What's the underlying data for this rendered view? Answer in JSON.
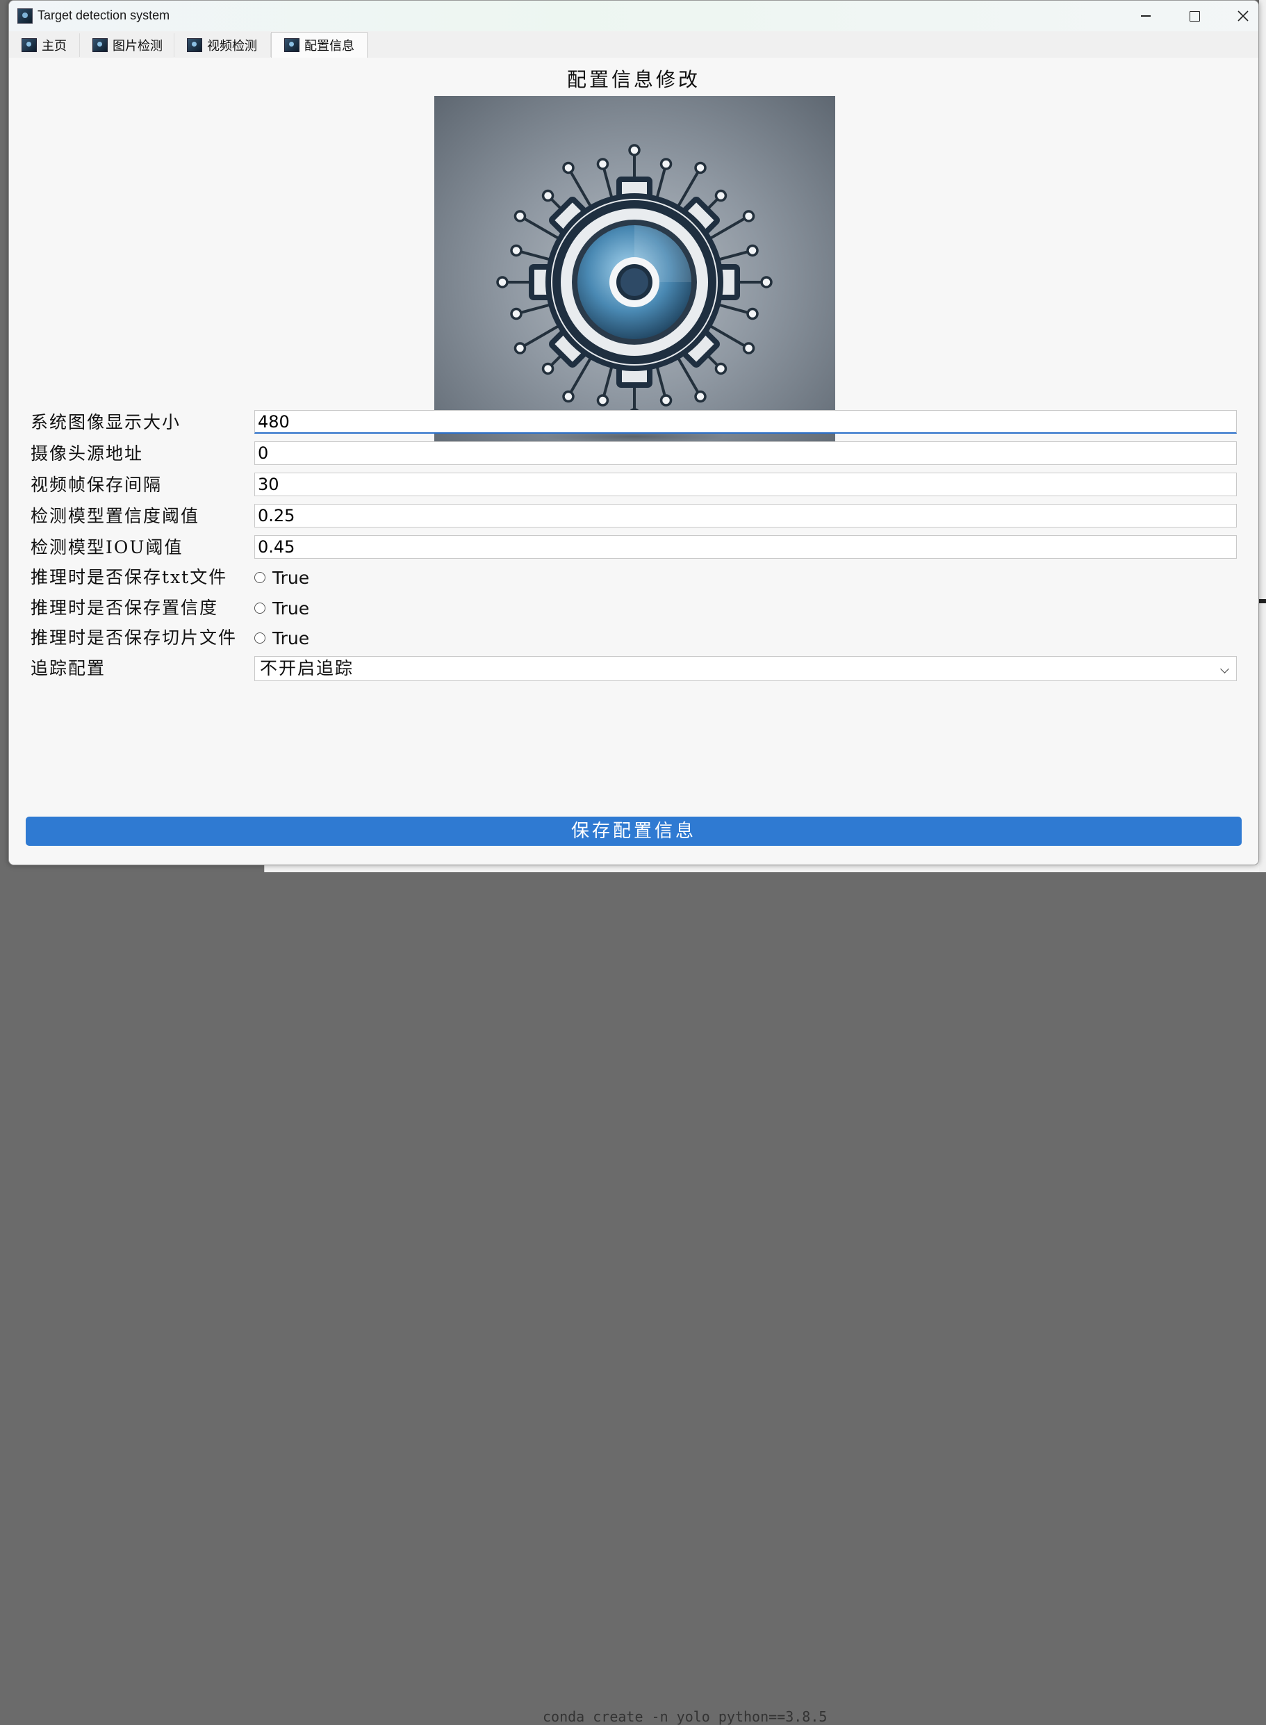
{
  "window": {
    "title": "Target detection system"
  },
  "tabs": [
    {
      "label": "主页"
    },
    {
      "label": "图片检测"
    },
    {
      "label": "视频检测"
    },
    {
      "label": "配置信息",
      "active": true
    }
  ],
  "page": {
    "title": "配置信息修改",
    "image_icon": "gear-circuit-icon"
  },
  "form": {
    "display_size": {
      "label": "系统图像显示大小",
      "value": "480"
    },
    "camera_source": {
      "label": "摄像头源地址",
      "value": "0"
    },
    "frame_interval": {
      "label": "视频帧保存间隔",
      "value": "30"
    },
    "conf_threshold": {
      "label": "检测模型置信度阈值",
      "value": "0.25"
    },
    "iou_threshold": {
      "label": "检测模型IOU阈值",
      "value": "0.45"
    },
    "save_txt": {
      "label": "推理时是否保存txt文件",
      "option": "True",
      "checked": false
    },
    "save_conf": {
      "label": "推理时是否保存置信度",
      "option": "True",
      "checked": false
    },
    "save_crop": {
      "label": "推理时是否保存切片文件",
      "option": "True",
      "checked": false
    },
    "tracking": {
      "label": "追踪配置",
      "value": "不开启追踪"
    }
  },
  "save_button": {
    "label": "保存配置信息"
  },
  "background": {
    "code_text": "conda create -n yolo python==3.8.5"
  },
  "colors": {
    "accent": "#2f7ad2",
    "window_bg": "#f7f7f7",
    "focus": "#2a6fc9"
  }
}
